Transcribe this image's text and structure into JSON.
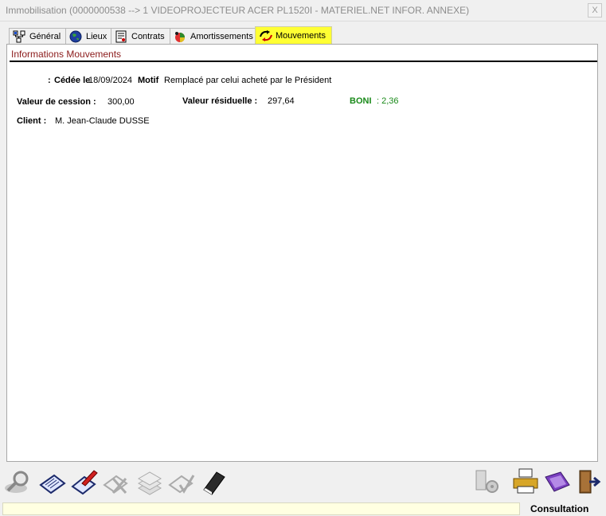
{
  "window": {
    "title": "Immobilisation (0000000538 --> 1 VIDEOPROJECTEUR ACER PL1520I - MATERIEL.NET INFOR. ANNEXE)",
    "close_label": "X"
  },
  "tabs": [
    {
      "label": "Général",
      "icon": "network-icon"
    },
    {
      "label": "Lieux",
      "icon": "globe-icon"
    },
    {
      "label": "Contrats",
      "icon": "contract-icon"
    },
    {
      "label": "Amortissements",
      "icon": "chart-icon"
    },
    {
      "label": "Mouvements",
      "icon": "movement-icon",
      "active": true
    }
  ],
  "section": {
    "title": "Informations Mouvements"
  },
  "movement": {
    "status_prefix": ":",
    "status_label": "Cédée le",
    "date": "18/09/2024",
    "reason_label": "Motif",
    "reason": "Remplacé par celui acheté par le Président",
    "sale_value_label": "Valeur de cession :",
    "sale_value": "300,00",
    "residual_label": "Valeur résiduelle :",
    "residual_value": "297,64",
    "boni_label": "BONI",
    "boni_value": ": 2,36",
    "client_label": "Client :",
    "client_name": "M. Jean-Claude DUSSE"
  },
  "toolbar": {
    "left": [
      "search-icon",
      "view-icon",
      "edit-icon",
      "delete-icon",
      "stack-icon",
      "validate-icon",
      "book-icon"
    ],
    "right": [
      "settings-icon",
      "print-icon",
      "folder-icon",
      "exit-icon"
    ]
  },
  "status": {
    "mode": "Consultation"
  },
  "colors": {
    "active_tab": "#ffff33",
    "section_title": "#8b1a1a",
    "boni": "#1a8a1a",
    "status_bg": "#ffffe1"
  }
}
